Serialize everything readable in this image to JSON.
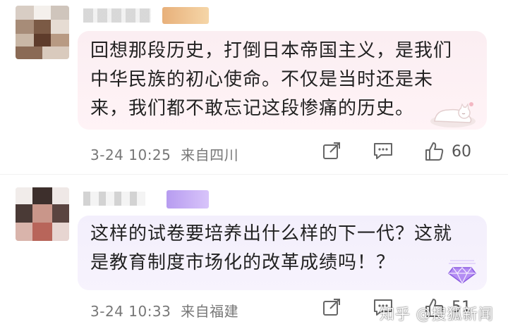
{
  "comments": [
    {
      "text": "回想那段历史，打倒日本帝国主义，是我们中华民族的初心使命。不仅是当时还是未来，我们都不敢忘记这段惨痛的历史。",
      "time": "3-24 10:25",
      "location": "来自四川",
      "likes": "60"
    },
    {
      "text": "这样的试卷要培养出什么样的下一代？这就是教育制度市场化的改革成绩吗！？",
      "time": "3-24 10:33",
      "location": "来自福建",
      "likes": "51"
    }
  ],
  "watermark": "知乎 @搜狐新闻",
  "icons": {
    "share": "share-icon",
    "reply": "comment-icon",
    "like": "thumbs-up-icon"
  },
  "colors": {
    "bubble_pink": "#fbeef2",
    "bubble_purple": "#f3effc",
    "meta_gray": "#777777"
  }
}
